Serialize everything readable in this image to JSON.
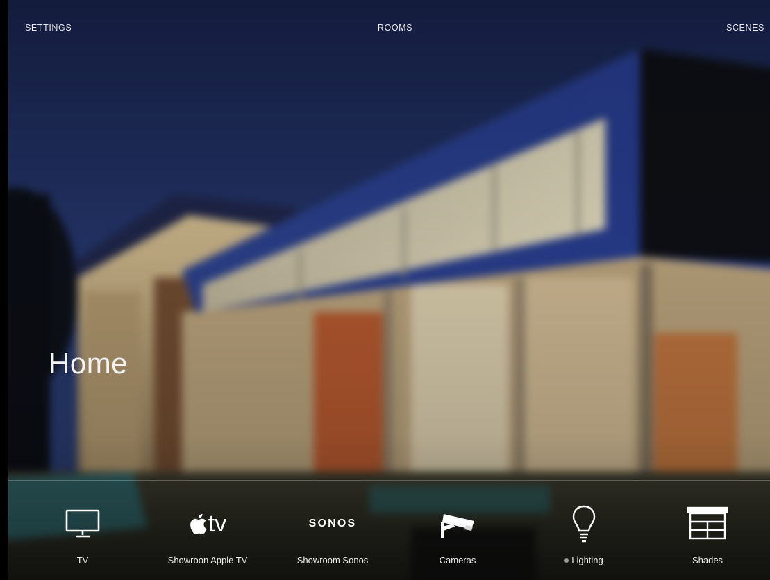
{
  "nav": {
    "settings": "SETTINGS",
    "rooms": "ROOMS",
    "scenes": "SCENES"
  },
  "room": {
    "title": "Home"
  },
  "services": [
    {
      "label": "TV",
      "icon": "monitor-icon"
    },
    {
      "label": "Showroon Apple TV",
      "icon": "apple-tv-logo-icon",
      "logo_text": "tv"
    },
    {
      "label": "Showroom Sonos",
      "icon": "sonos-logo-icon",
      "logo_text": "SONOS"
    },
    {
      "label": "Cameras",
      "icon": "security-camera-icon"
    },
    {
      "label": "Lighting",
      "icon": "light-bulb-icon",
      "status": "off"
    },
    {
      "label": "Shades",
      "icon": "window-shade-icon"
    }
  ],
  "colors": {
    "text": "#e6e6e6",
    "sky": "#1c2a55",
    "background": "#000000",
    "status_dot": "#9a9a9a"
  }
}
